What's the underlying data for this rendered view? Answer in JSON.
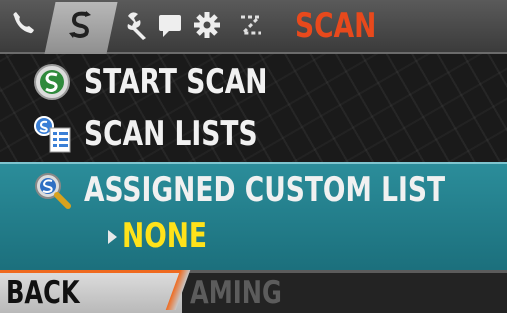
{
  "header": {
    "title": "SCAN",
    "tabs": [
      {
        "icon": "phone-icon"
      },
      {
        "icon": "scan-icon",
        "active": true
      },
      {
        "icon": "wrench-icon"
      },
      {
        "icon": "message-icon"
      },
      {
        "icon": "gear-icon"
      },
      {
        "icon": "zone-icon"
      }
    ]
  },
  "menu": {
    "items": [
      {
        "label": "START SCAN",
        "icon": "scan-start-icon"
      },
      {
        "label": "SCAN LISTS",
        "icon": "scan-list-icon"
      },
      {
        "label": "ASSIGNED CUSTOM LIST",
        "icon": "scan-search-icon",
        "selected": true,
        "value": "NONE"
      }
    ]
  },
  "softkeys": {
    "left": "BACK",
    "right": "AMING"
  },
  "colors": {
    "accent_orange": "#e8491c",
    "selection_teal": "#1f7f8c",
    "value_yellow": "#ffe21a"
  }
}
